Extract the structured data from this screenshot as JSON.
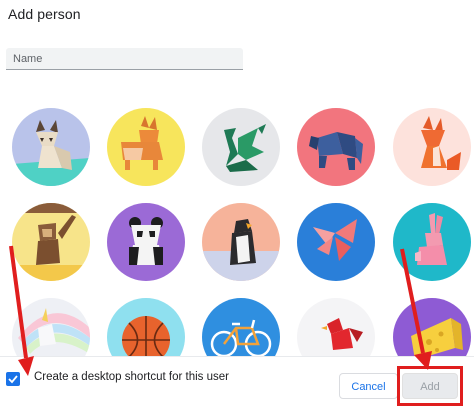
{
  "dialog": {
    "title": "Add person",
    "name_placeholder": "Name",
    "name_value": ""
  },
  "avatars": [
    {
      "name": "cat"
    },
    {
      "name": "corgi"
    },
    {
      "name": "dragon"
    },
    {
      "name": "elephant"
    },
    {
      "name": "fox"
    },
    {
      "name": "monkey"
    },
    {
      "name": "panda"
    },
    {
      "name": "penguin"
    },
    {
      "name": "butterfly"
    },
    {
      "name": "rabbit"
    },
    {
      "name": "unicorn"
    },
    {
      "name": "basketball"
    },
    {
      "name": "bicycle"
    },
    {
      "name": "bird"
    },
    {
      "name": "cheese"
    }
  ],
  "footer": {
    "checkbox_checked": true,
    "checkbox_label": "Create a desktop shortcut for this user",
    "cancel_label": "Cancel",
    "add_label": "Add"
  },
  "colors": {
    "accent": "#1a73e8",
    "annotation_red": "#e01e1e",
    "disabled_button_bg": "#e8eaed"
  }
}
